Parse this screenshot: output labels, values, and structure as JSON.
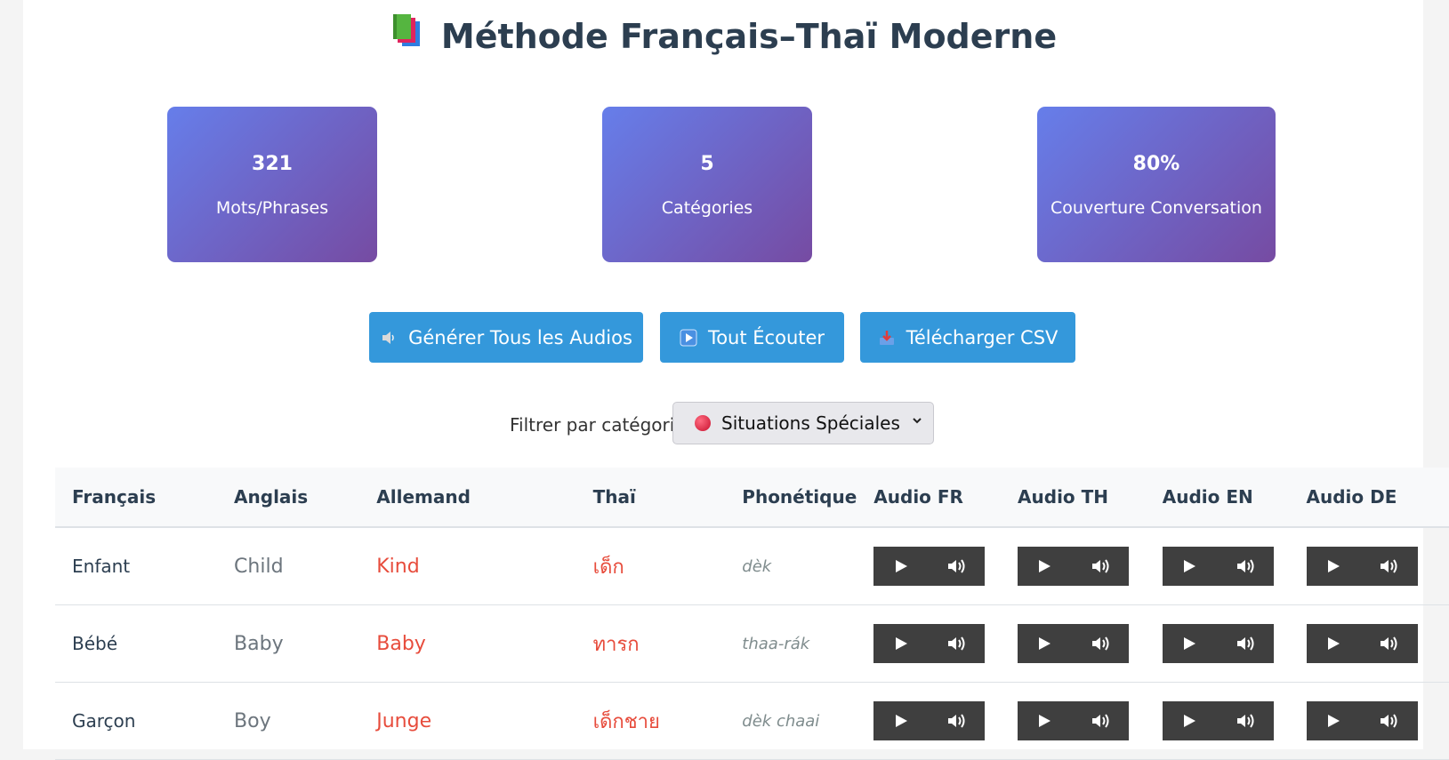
{
  "header": {
    "title": "Méthode Français–Thaï Moderne",
    "icon": "books-icon"
  },
  "stats": [
    {
      "value": "321",
      "label": "Mots/Phrases"
    },
    {
      "value": "5",
      "label": "Catégories"
    },
    {
      "value": "80%",
      "label": "Couverture Conversation"
    }
  ],
  "actions": [
    {
      "label": "Générer Tous les Audios",
      "icon": "speaker-icon"
    },
    {
      "label": "Tout Écouter",
      "icon": "play-icon"
    },
    {
      "label": "Télécharger CSV",
      "icon": "download-tray-icon"
    }
  ],
  "filter": {
    "label": "Filtrer par catégorie:",
    "selected": "Situations Spéciales",
    "selected_icon": "red-circle-icon"
  },
  "table": {
    "headers": [
      "Français",
      "Anglais",
      "Allemand",
      "Thaï",
      "Phonétique",
      "Audio FR",
      "Audio TH",
      "Audio EN",
      "Audio DE"
    ],
    "rows": [
      {
        "fr": "Enfant",
        "en": "Child",
        "de": "Kind",
        "th": "เด็ก",
        "ph": "dèk"
      },
      {
        "fr": "Bébé",
        "en": "Baby",
        "de": "Baby",
        "th": "ทารก",
        "ph": "thaa-rák"
      },
      {
        "fr": "Garçon",
        "en": "Boy",
        "de": "Junge",
        "th": "เด็กชาย",
        "ph": "dèk chaai"
      }
    ]
  },
  "colors": {
    "accent": "#3498db",
    "stat_gradient_start": "#667eea",
    "stat_gradient_end": "#764ba2",
    "highlight": "#e74c3c",
    "player": "#3f3f3f"
  }
}
